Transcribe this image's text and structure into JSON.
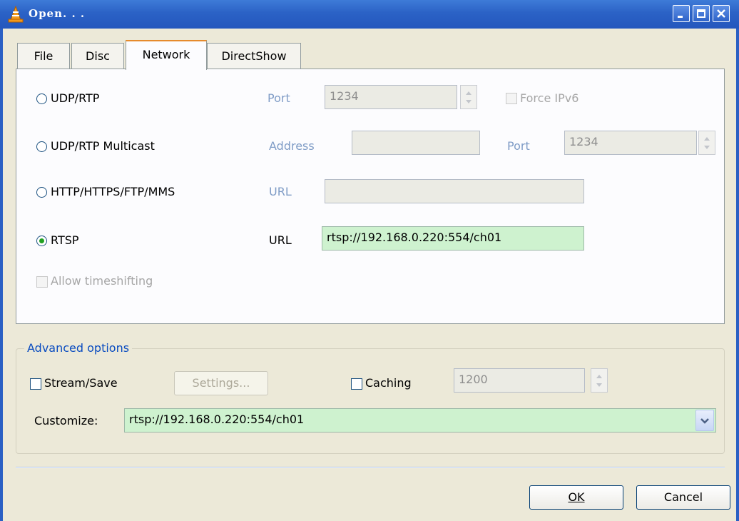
{
  "window": {
    "title": "Open. . .",
    "icon": "vlc-cone-icon",
    "controls": [
      "minimize-icon",
      "maximize-icon",
      "close-icon"
    ]
  },
  "tabs": [
    {
      "label": "File",
      "active": false
    },
    {
      "label": "Disc",
      "active": false
    },
    {
      "label": "Network",
      "active": true
    },
    {
      "label": "DirectShow",
      "active": false
    }
  ],
  "network": {
    "udp": {
      "label": "UDP/RTP",
      "selected": false,
      "port_label": "Port",
      "port_value": "1234",
      "force_ipv6_label": "Force IPv6"
    },
    "multicast": {
      "label": "UDP/RTP Multicast",
      "selected": false,
      "address_label": "Address",
      "address_value": "",
      "port_label": "Port",
      "port_value": "1234"
    },
    "http": {
      "label": "HTTP/HTTPS/FTP/MMS",
      "selected": false,
      "url_label": "URL",
      "url_value": ""
    },
    "rtsp": {
      "label": "RTSP",
      "selected": true,
      "url_label": "URL",
      "url_value": "rtsp://192.168.0.220:554/ch01"
    },
    "timeshift_label": "Allow timeshifting"
  },
  "advanced": {
    "title": "Advanced options",
    "stream_save_label": "Stream/Save",
    "settings_label": "Settings...",
    "caching_label": "Caching",
    "caching_value": "1200",
    "customize_label": "Customize:",
    "customize_value": "rtsp://192.168.0.220:554/ch01"
  },
  "buttons": {
    "ok_label": "OK",
    "cancel_label": "Cancel"
  },
  "colors": {
    "titlebar": "#2b62c6",
    "active_field": "#cef2cf",
    "tab_highlight": "#e68b2c"
  }
}
